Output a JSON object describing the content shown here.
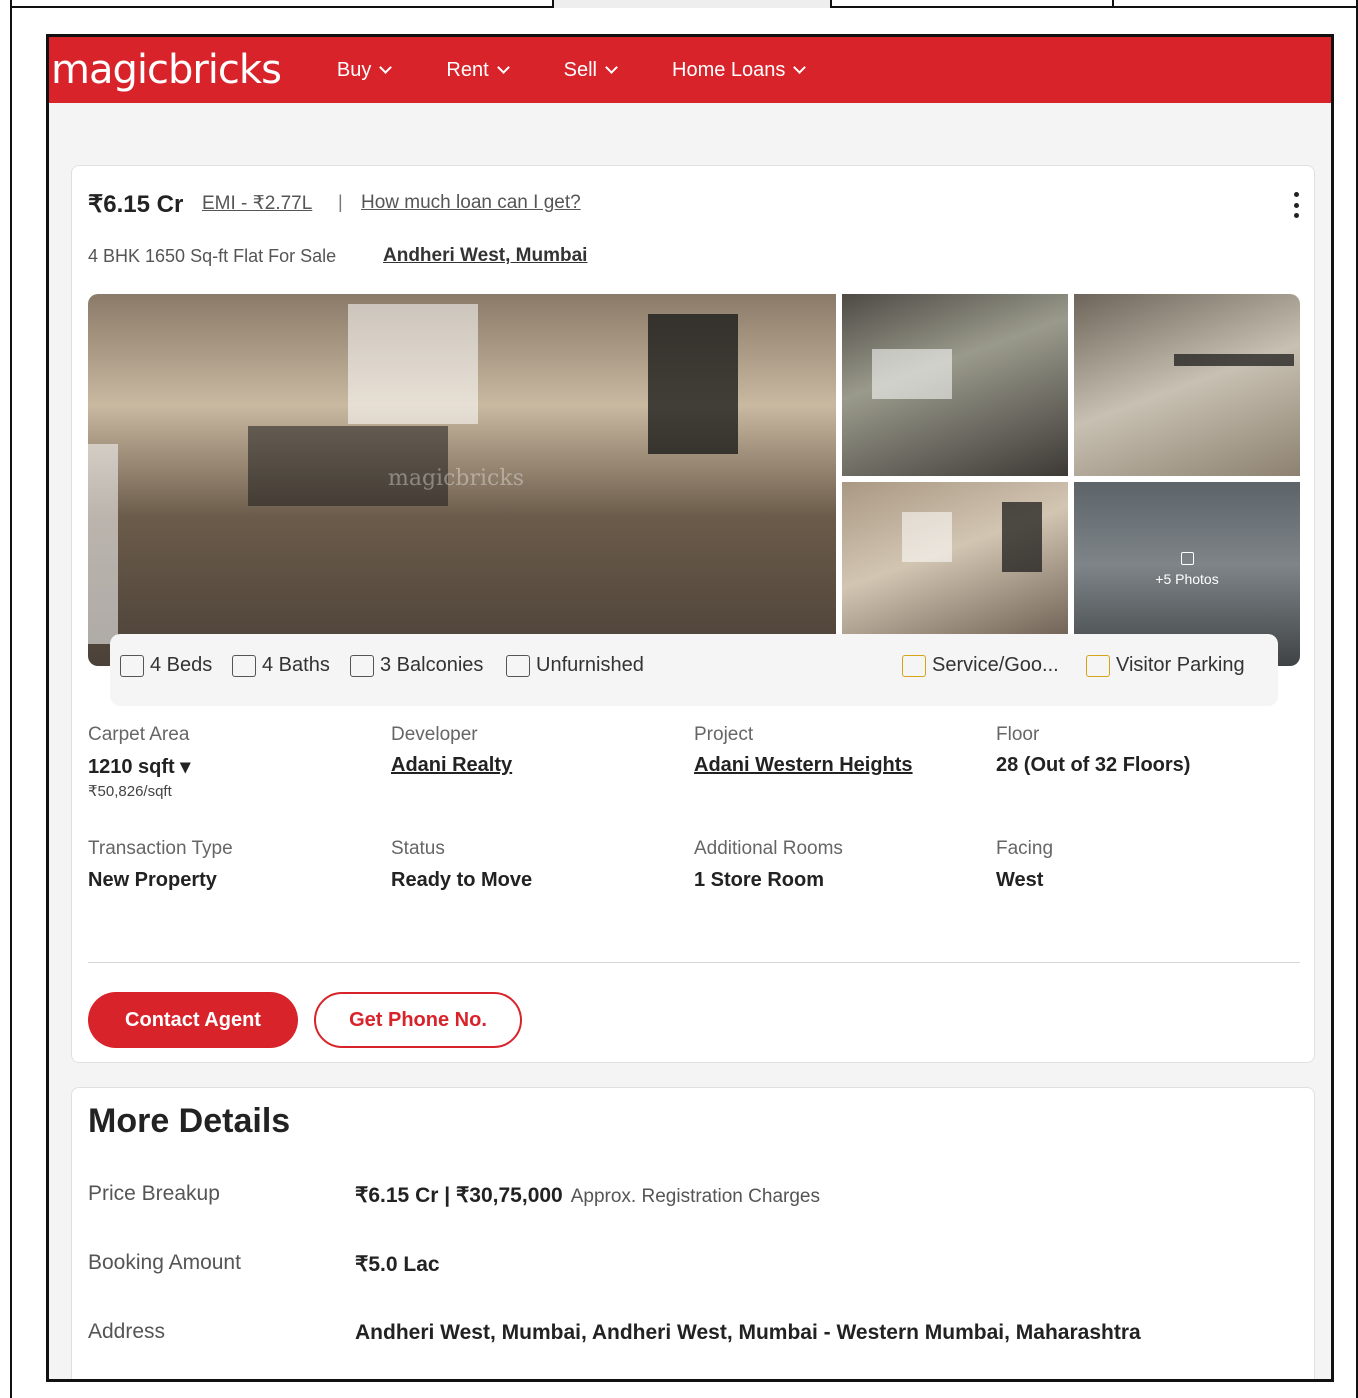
{
  "brand": {
    "name": "magicbricks",
    "color": "#d8232a"
  },
  "nav": {
    "items": [
      {
        "label": "Buy"
      },
      {
        "label": "Rent"
      },
      {
        "label": "Sell"
      },
      {
        "label": "Home Loans"
      }
    ]
  },
  "listing": {
    "price": "₹6.15 Cr",
    "emi": "EMI - ₹2.77L",
    "separator": "|",
    "loan_link": "How much loan can I get?",
    "subtitle": "4 BHK 1650 Sq-ft Flat For Sale",
    "location": "Andheri West, Mumbai",
    "watermark": "magicbricks",
    "more_photos": "+5 Photos",
    "amenities": [
      {
        "label": "4 Beds",
        "icon": "bed-icon"
      },
      {
        "label": "4 Baths",
        "icon": "bath-icon"
      },
      {
        "label": "3 Balconies",
        "icon": "balcony-icon"
      },
      {
        "label": "Unfurnished",
        "icon": "furnishing-icon"
      },
      {
        "label": "Service/Goo...",
        "icon": "service-lift-icon"
      },
      {
        "label": "Visitor Parking",
        "icon": "parking-icon"
      }
    ],
    "details": [
      {
        "label": "Carpet Area",
        "value": "1210 sqft ▾",
        "sub": "₹50,826/sqft"
      },
      {
        "label": "Developer",
        "value": "Adani Realty"
      },
      {
        "label": "Project",
        "value": "Adani Western Heights"
      },
      {
        "label": "Floor",
        "value": "28 (Out of 32 Floors)"
      },
      {
        "label": "Transaction Type",
        "value": "New Property"
      },
      {
        "label": "Status",
        "value": "Ready to Move"
      },
      {
        "label": "Additional Rooms",
        "value": "1 Store Room"
      },
      {
        "label": "Facing",
        "value": "West"
      }
    ],
    "buttons": {
      "contact": "Contact Agent",
      "phone": "Get Phone No."
    }
  },
  "more_details": {
    "title": "More Details",
    "rows": [
      {
        "label": "Price Breakup",
        "value": "₹6.15 Cr | ₹30,75,000",
        "note": "Approx. Registration Charges"
      },
      {
        "label": "Booking Amount",
        "value": "₹5.0 Lac"
      },
      {
        "label": "Address",
        "value": "Andheri West, Mumbai, Andheri West, Mumbai - Western Mumbai, Maharashtra"
      }
    ]
  }
}
